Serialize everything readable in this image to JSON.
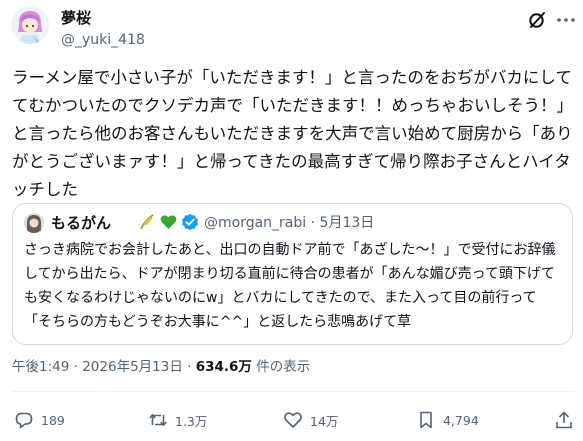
{
  "author": {
    "name": "夢桜",
    "handle": "@_yuki_418"
  },
  "tweet": {
    "text": "ラーメン屋で小さい子が「いただきます！」と言ったのをおぢがバカにしててむかついたのでクソデカ声で「いただきます！！めっちゃおいしそう！」と言ったら他のお客さんもいただきますを大声で言い始めて厨房から「ありがとうございまァす！」と帰ってきたの最高すぎて帰り際お子さんとハイタッチした"
  },
  "quote": {
    "name": "もるがん",
    "handle": "@morgan_rabi",
    "separator": "·",
    "date": "5月13日",
    "text": "さっき病院でお会計したあと、出口の自動ドア前で「あざした〜！」で受付にお辞儀してから出たら、ドアが閉まり切る直前に待合の患者が「あんな媚び売って頭下げても安くなるわけじゃないのにw」とバカにしてきたので、また入って目の前行って「そちらの方もどうぞお大事に^^」と返したら悲鳴あげて草"
  },
  "meta": {
    "time": "午後1:49",
    "separator": "·",
    "date": "2026年5月13日",
    "views": "634.6万",
    "views_label": "件の表示"
  },
  "actions": {
    "replies": "189",
    "reposts": "1.3万",
    "likes": "14万",
    "bookmarks": "4,794"
  },
  "colors": {
    "text": "#0f1419",
    "secondary": "#536471",
    "border": "#cfd9de",
    "verified": "#1d9bf0",
    "heart": "#3aa635"
  }
}
